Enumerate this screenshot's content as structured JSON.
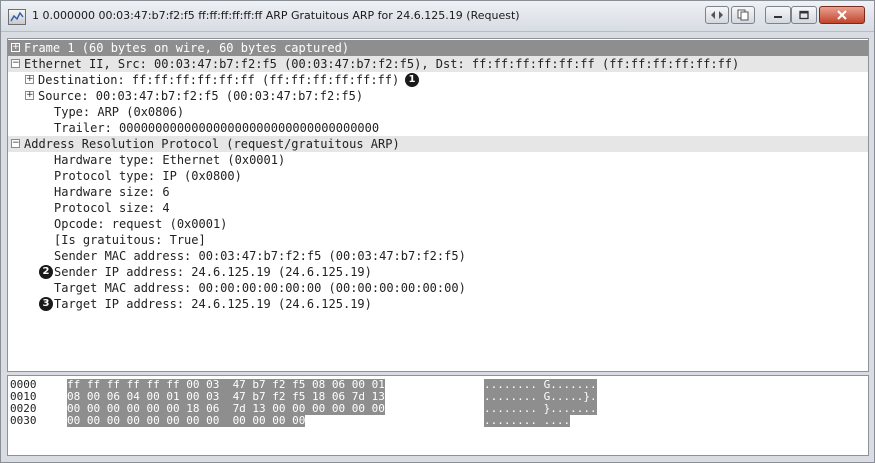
{
  "window": {
    "title": "1 0.000000 00:03:47:b7:f2:f5 ff:ff:ff:ff:ff:ff ARP Gratuitous ARP for 24.6.125.19 (Request)"
  },
  "icons": {
    "app": "wireshark-packet-icon",
    "prev_next": "prev-next-packet-icon",
    "copy": "copy-icon",
    "minimize": "minimize-icon",
    "maximize": "maximize-icon",
    "close": "close-icon"
  },
  "tree": [
    {
      "text": "Frame 1 (60 bytes on wire, 60 bytes captured)",
      "expander": "+",
      "indent": 0,
      "style": "selected"
    },
    {
      "text": "Ethernet II, Src: 00:03:47:b7:f2:f5 (00:03:47:b7:f2:f5), Dst: ff:ff:ff:ff:ff:ff (ff:ff:ff:ff:ff:ff)",
      "expander": "−",
      "indent": 0,
      "style": "header"
    },
    {
      "text": "Destination: ff:ff:ff:ff:ff:ff (ff:ff:ff:ff:ff:ff)",
      "expander": "+",
      "indent": 1,
      "callout_after": "1"
    },
    {
      "text": "Source: 00:03:47:b7:f2:f5 (00:03:47:b7:f2:f5)",
      "expander": "+",
      "indent": 1
    },
    {
      "text": "Type: ARP (0x0806)",
      "indent": 2
    },
    {
      "text": "Trailer: 000000000000000000000000000000000000",
      "indent": 2
    },
    {
      "text": "Address Resolution Protocol (request/gratuitous ARP)",
      "expander": "−",
      "indent": 0,
      "style": "header"
    },
    {
      "text": "Hardware type: Ethernet (0x0001)",
      "indent": 2
    },
    {
      "text": "Protocol type: IP (0x0800)",
      "indent": 2
    },
    {
      "text": "Hardware size: 6",
      "indent": 2
    },
    {
      "text": "Protocol size: 4",
      "indent": 2
    },
    {
      "text": "Opcode: request (0x0001)",
      "indent": 2
    },
    {
      "text": "[Is gratuitous: True]",
      "indent": 2
    },
    {
      "text": "Sender MAC address: 00:03:47:b7:f2:f5 (00:03:47:b7:f2:f5)",
      "indent": 2
    },
    {
      "text": "Sender IP address: 24.6.125.19 (24.6.125.19)",
      "indent": 2,
      "callout_before": "2"
    },
    {
      "text": "Target MAC address: 00:00:00:00:00:00 (00:00:00:00:00:00)",
      "indent": 2
    },
    {
      "text": "Target IP address: 24.6.125.19 (24.6.125.19)",
      "indent": 2,
      "callout_before": "3"
    }
  ],
  "hex": [
    {
      "offset": "0000",
      "bytes": "ff ff ff ff ff ff 00 03  47 b7 f2 f5 08 06 00 01",
      "ascii": "........ G......."
    },
    {
      "offset": "0010",
      "bytes": "08 00 06 04 00 01 00 03  47 b7 f2 f5 18 06 7d 13",
      "ascii": "........ G.....}."
    },
    {
      "offset": "0020",
      "bytes": "00 00 00 00 00 00 18 06  7d 13 00 00 00 00 00 00",
      "ascii": "........ }......."
    },
    {
      "offset": "0030",
      "bytes": "00 00 00 00 00 00 00 00  00 00 00 00",
      "ascii": "........ ...."
    }
  ]
}
